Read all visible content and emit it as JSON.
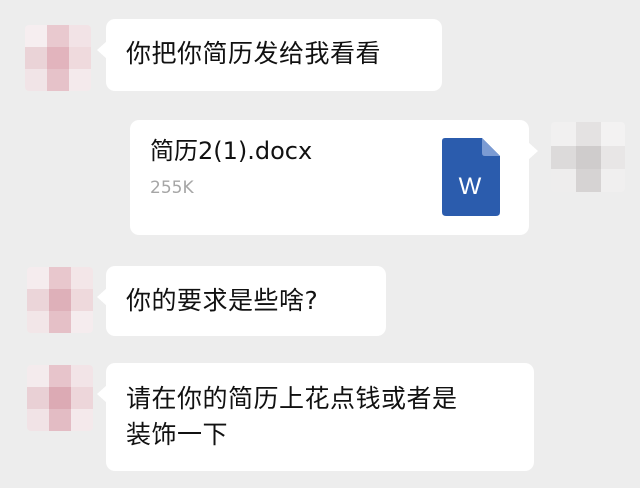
{
  "messages": [
    {
      "from": "contact",
      "text": "你把你简历发给我看看"
    },
    {
      "from": "me",
      "type": "file",
      "file_name": "简历2(1).docx",
      "file_size": "255K",
      "icon": "word-document-icon",
      "icon_letter": "W"
    },
    {
      "from": "contact",
      "text": "你的要求是些啥?"
    },
    {
      "from": "contact",
      "text": "请在你的简历上花点钱或者是\n装饰一下"
    }
  ],
  "colors": {
    "background": "#ededed",
    "bubble": "#ffffff",
    "word_blue": "#2b5cad",
    "file_size_text": "#a6a6a6"
  }
}
